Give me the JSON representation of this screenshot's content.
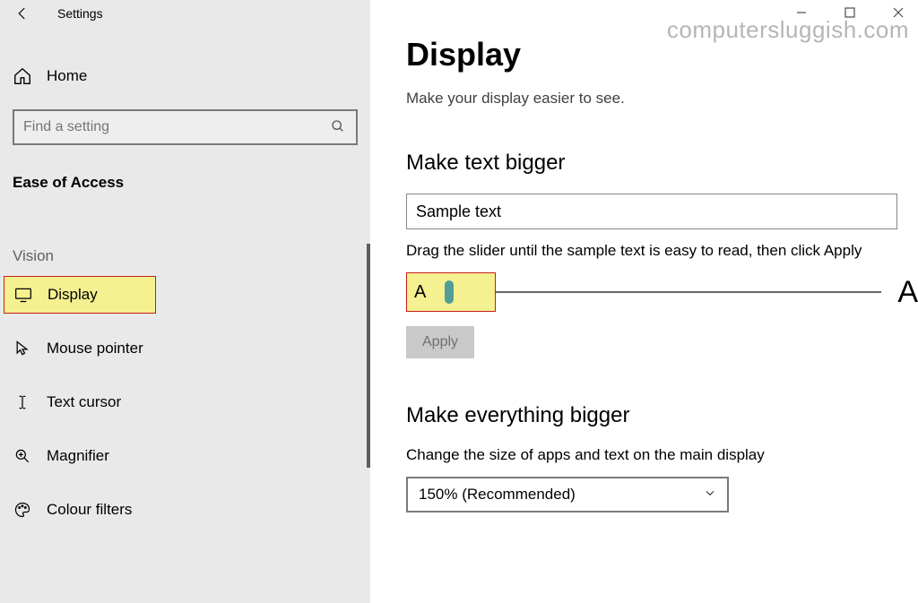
{
  "titlebar": {
    "title": "Settings"
  },
  "sidebar": {
    "home": "Home",
    "search_placeholder": "Find a setting",
    "section": "Ease of Access",
    "group": "Vision",
    "items": [
      {
        "label": "Display"
      },
      {
        "label": "Mouse pointer"
      },
      {
        "label": "Text cursor"
      },
      {
        "label": "Magnifier"
      },
      {
        "label": "Colour filters"
      }
    ]
  },
  "watermark": "computersluggish.com",
  "main": {
    "title": "Display",
    "subtitle": "Make your display easier to see.",
    "text_bigger": {
      "heading": "Make text bigger",
      "sample": "Sample text",
      "instruction": "Drag the slider until the sample text is easy to read, then click Apply",
      "small_label": "A",
      "big_label": "A",
      "apply": "Apply"
    },
    "everything_bigger": {
      "heading": "Make everything bigger",
      "desc": "Change the size of apps and text on the main display",
      "selected": "150% (Recommended)"
    }
  }
}
